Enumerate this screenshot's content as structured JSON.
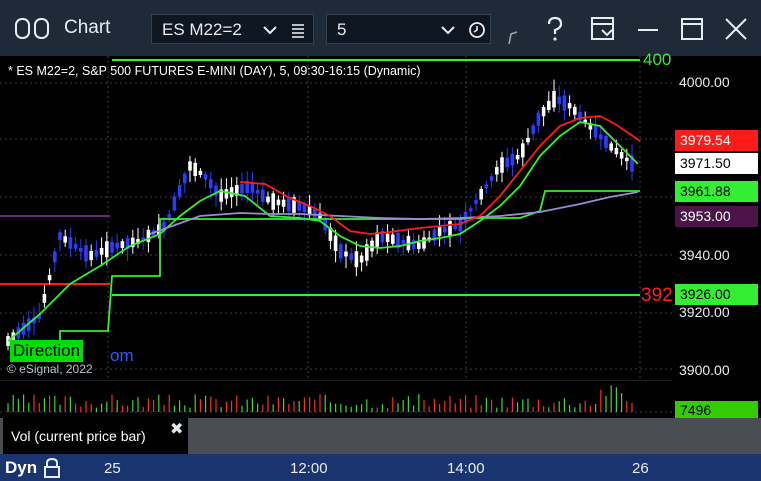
{
  "window": {
    "title": "Chart",
    "symbol": "ES M22=2",
    "interval": "5"
  },
  "chart": {
    "study_label": "* ES M22=2, S&P 500 FUTURES E-MINI (DAY), 5, 09:30-16:15 (Dynamic)",
    "copyright": "© eSignal, 2022",
    "direction_label": "Direction",
    "partial_link_text": "om",
    "partial_top_level": "400",
    "partial_mid_level": "392",
    "price_ticks": [
      "4000.00",
      "3940.00",
      "3920.00",
      "3900.00"
    ],
    "price_badges": {
      "red_value": "3979.54",
      "last_price": "3971.50",
      "green_value": "3961.88",
      "purple_value": "3953.00",
      "level_value": "3926.00"
    },
    "colors": {
      "red_line": "#ff1a1a",
      "green_line": "#33ee33",
      "purple_line": "#9b8ad6",
      "bar_white": "#ffffff",
      "bar_blue": "#2a3cff"
    }
  },
  "volume": {
    "label": "Vol (current price bar)",
    "value": "7496"
  },
  "time_axis": {
    "mode": "Dyn",
    "labels": [
      "25",
      "12:00",
      "14:00",
      "26"
    ]
  }
}
